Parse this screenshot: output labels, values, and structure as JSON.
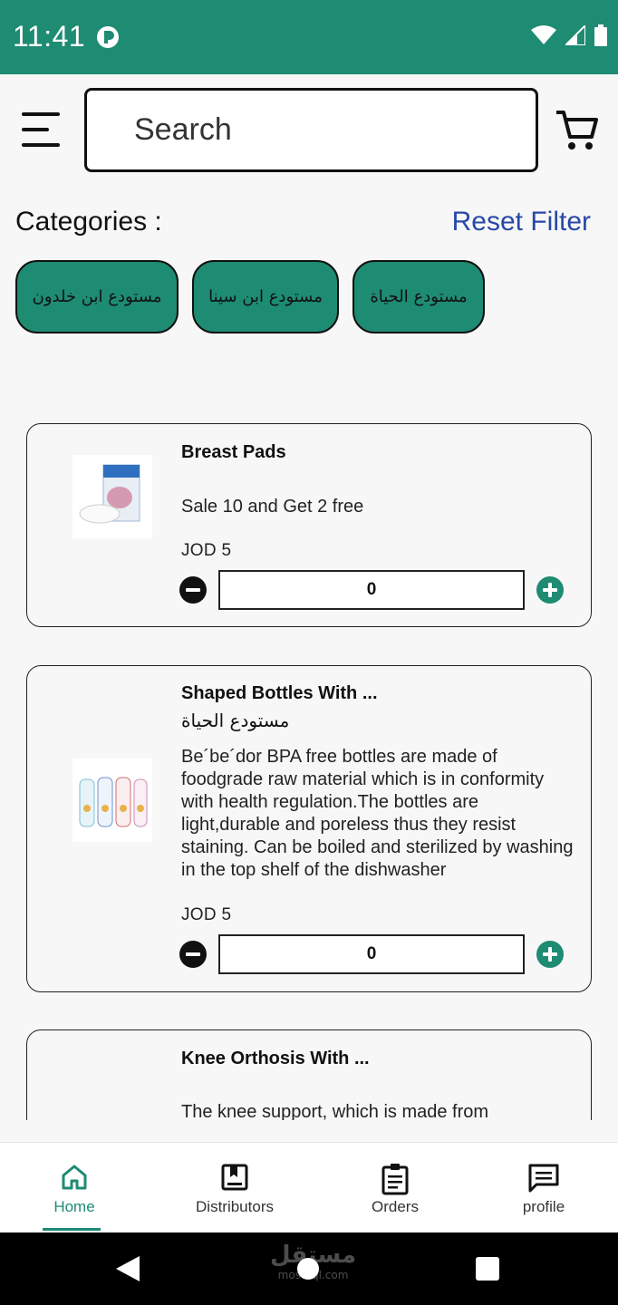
{
  "status_bar": {
    "time": "11:41"
  },
  "search": {
    "placeholder": "Search"
  },
  "categories": {
    "title": "Categories :",
    "reset_label": "Reset Filter",
    "chips": [
      "مستودع ابن خلدون",
      "مستودع ابن سينا",
      "مستودع الحياة"
    ]
  },
  "products": [
    {
      "name": "Breast Pads",
      "subtitle": "",
      "description": "Sale 10 and Get 2 free",
      "price": "JOD 5",
      "quantity": "0"
    },
    {
      "name": "Shaped Bottles With ...",
      "subtitle": "مستودع الحياة",
      "description": "Be´be´dor BPA free bottles are made of foodgrade raw material which is in conformity with health regulation.The bottles are light,durable and poreless thus they resist staining. Can be boiled and sterilized by washing in the top shelf of the dishwasher",
      "price": "JOD 5",
      "quantity": "0"
    },
    {
      "name": "Knee Orthosis With ...",
      "subtitle": "",
      "description": "The knee support, which is made from",
      "price": "",
      "quantity": ""
    }
  ],
  "bottom_nav": {
    "items": [
      {
        "label": "Home",
        "icon": "home-icon",
        "active": true
      },
      {
        "label": "Distributors",
        "icon": "bookmark-book-icon",
        "active": false
      },
      {
        "label": "Orders",
        "icon": "clipboard-icon",
        "active": false
      },
      {
        "label": "profile",
        "icon": "message-icon",
        "active": false
      }
    ]
  },
  "watermark": {
    "arabic": "مستقل",
    "latin": "mostaql.com"
  },
  "colors": {
    "primary": "#1e8b73",
    "link": "#2848a8",
    "background": "#f7f7f7"
  }
}
